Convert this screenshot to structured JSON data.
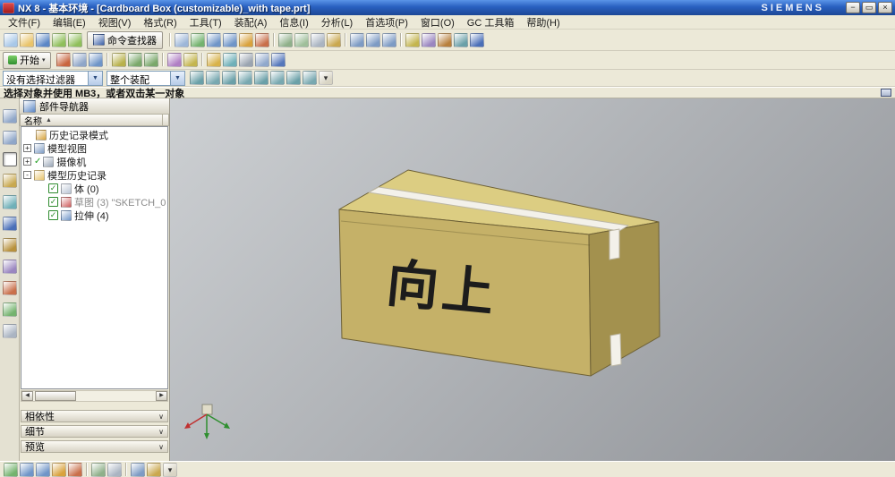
{
  "window": {
    "title": "NX 8 - 基本环境 - [Cardboard Box (customizable)_with tape.prt]",
    "brand": "SIEMENS",
    "controls": {
      "minimize": "−",
      "restore": "▭",
      "close": "×"
    }
  },
  "menu": {
    "items": [
      "文件(F)",
      "编辑(E)",
      "视图(V)",
      "格式(R)",
      "工具(T)",
      "装配(A)",
      "信息(I)",
      "分析(L)",
      "首选项(P)",
      "窗口(O)",
      "GC 工具箱",
      "帮助(H)"
    ]
  },
  "toolbars": {
    "standard": {
      "command_finder_label": "命令查找器",
      "icons_a": [
        {
          "n": "new-icon",
          "c": "#a8c8e8"
        },
        {
          "n": "open-icon",
          "c": "#e9c46a"
        },
        {
          "n": "save-icon",
          "c": "#5b87c6"
        },
        {
          "n": "undo-icon",
          "c": "#8fbf5a"
        },
        {
          "n": "redo-icon",
          "c": "#8fbf5a"
        }
      ],
      "icons_b": [
        {
          "sep": true
        },
        {
          "n": "window-icon",
          "c": "#9db6d8"
        },
        {
          "n": "refresh-icon",
          "c": "#74b36e"
        },
        {
          "n": "fit-window-icon",
          "c": "#6f95c8"
        },
        {
          "n": "zoom-icon",
          "c": "#6f95c8"
        },
        {
          "n": "pan-icon",
          "c": "#d9a23c"
        },
        {
          "n": "rotate-icon",
          "c": "#c96f4a"
        },
        {
          "sep": true
        },
        {
          "n": "shaded-with-edges-icon",
          "c": "#8fb08a"
        },
        {
          "n": "shaded-icon",
          "c": "#9fbf9a"
        },
        {
          "n": "wireframe-icon",
          "c": "#aab4c2"
        },
        {
          "n": "studio-render-icon",
          "c": "#caa84e"
        },
        {
          "sep": true
        },
        {
          "n": "front-view-icon",
          "c": "#7d9bc4"
        },
        {
          "n": "top-view-icon",
          "c": "#7d9bc4"
        },
        {
          "n": "isometric-view-icon",
          "c": "#7d9bc4"
        },
        {
          "sep": true
        },
        {
          "n": "show-hide-icon",
          "c": "#c4b54e"
        },
        {
          "n": "layer-settings-icon",
          "c": "#9a86c0"
        },
        {
          "n": "measure-distance-icon",
          "c": "#b8803c"
        },
        {
          "n": "snap-point-icon",
          "c": "#6aa0a8"
        },
        {
          "n": "help-icon",
          "c": "#4a6fb8"
        }
      ]
    },
    "view": {
      "start_label": "开始",
      "start_arrow": "▾",
      "icons": [
        {
          "n": "sketch-icon",
          "c": "#c9653e"
        },
        {
          "n": "datum-plane-icon",
          "c": "#8fa6c8"
        },
        {
          "n": "extrude-icon",
          "c": "#6f95c8"
        },
        {
          "sep": true
        },
        {
          "n": "point-icon",
          "c": "#b8b14a"
        },
        {
          "n": "line-icon",
          "c": "#7aa86a"
        },
        {
          "n": "arc-icon",
          "c": "#7aa86a"
        },
        {
          "sep": true
        },
        {
          "n": "object-display-icon",
          "c": "#b07fc4"
        },
        {
          "n": "show-hide-toggle-icon",
          "c": "#c4b54e"
        },
        {
          "sep": true
        },
        {
          "n": "information-icon",
          "c": "#d8b24a"
        },
        {
          "n": "analysis-icon",
          "c": "#6fb0b8"
        },
        {
          "n": "preferences-icon",
          "c": "#9aa4b0"
        },
        {
          "n": "window-cascade-icon",
          "c": "#90a8cc"
        },
        {
          "n": "help-doc-icon",
          "c": "#5577bb"
        }
      ]
    },
    "selection": {
      "icons": [
        {
          "n": "snap-point-toggle-icon",
          "c": "#6aa0a8"
        },
        {
          "n": "endpoint-snap-icon",
          "c": "#78a8b0"
        },
        {
          "n": "midpoint-snap-icon",
          "c": "#6aa0a8"
        },
        {
          "n": "control-point-snap-icon",
          "c": "#78a8b0"
        },
        {
          "n": "intersection-snap-icon",
          "c": "#6aa0a8"
        },
        {
          "n": "arc-center-snap-icon",
          "c": "#78a8b0"
        },
        {
          "n": "quadrant-snap-icon",
          "c": "#6aa0a8"
        },
        {
          "n": "existing-point-snap-icon",
          "c": "#78a8b0"
        },
        {
          "n": "overflow-chevron-icon",
          "c": "#d8d4c4",
          "g": "▾"
        }
      ]
    },
    "bottom": {
      "icons": [
        {
          "n": "refresh-view-icon",
          "c": "#74b36e"
        },
        {
          "n": "fit-view-icon",
          "c": "#6f95c8"
        },
        {
          "n": "zoom-view-icon",
          "c": "#6f95c8"
        },
        {
          "n": "pan-view-icon",
          "c": "#d9a23c"
        },
        {
          "n": "rotate-view-icon",
          "c": "#c96f4a"
        },
        {
          "sep": true
        },
        {
          "n": "shaded-mode-icon",
          "c": "#8fb08a"
        },
        {
          "n": "wireframe-mode-icon",
          "c": "#aab4c2"
        },
        {
          "sep": true
        },
        {
          "n": "trimetric-view-icon",
          "c": "#7d9bc4"
        },
        {
          "n": "snapshot-icon",
          "c": "#caa84e"
        },
        {
          "n": "overflow-chevron-icon",
          "c": "#d8d4c4",
          "g": "▾"
        }
      ]
    }
  },
  "selection_bar": {
    "filter_value": "没有选择过滤器",
    "scope_value": "整个装配",
    "dropdown_arrow": "▼"
  },
  "prompt": {
    "text": "选择对象并使用 MB3，或者双击某一对象"
  },
  "resource_bar": {
    "icons": [
      {
        "n": "assembly-navigator-icon",
        "c": "#8fa6c8"
      },
      {
        "n": "constraint-navigator-icon",
        "c": "#8fa6c8"
      },
      {
        "n": "part-navigator-icon",
        "c": "#5b87c6",
        "a": true
      },
      {
        "n": "reuse-library-icon",
        "c": "#c8a84e"
      },
      {
        "n": "hd3d-tools-icon",
        "c": "#6fb0b8"
      },
      {
        "n": "web-browser-icon",
        "c": "#4a6fb8"
      },
      {
        "n": "history-palette-icon",
        "c": "#b8913c"
      },
      {
        "n": "process-studio-icon",
        "c": "#9a86c0"
      },
      {
        "n": "manufacturing-wizard-icon",
        "c": "#c96f4a"
      },
      {
        "n": "roles-icon",
        "c": "#74b36e"
      },
      {
        "n": "system-scenes-icon",
        "c": "#aab4c2"
      }
    ]
  },
  "part_navigator": {
    "title": "部件导航器",
    "name_column": "名称",
    "sort_glyph": "▲",
    "check_glyph": "✓",
    "scroll_left": "◀",
    "scroll_right": "▶",
    "section_chevron": "∨",
    "rows": [
      {
        "label": "历史记录模式",
        "icon": "history-mode-icon",
        "ic": "#d8a43c",
        "level": 0
      },
      {
        "label": "模型视图",
        "icon": "model-views-icon",
        "ic": "#7d9bc4",
        "level": 0,
        "expander": "+"
      },
      {
        "label": "摄像机",
        "icon": "cameras-icon",
        "ic": "#9aa7b8",
        "level": 0,
        "expander": "+",
        "check": true
      },
      {
        "label": "模型历史记录",
        "icon": "model-history-folder-icon",
        "ic": "#e9c46a",
        "level": 0,
        "expander": "-"
      },
      {
        "label": "体 (0)",
        "icon": "body-icon",
        "ic": "#b9c4d4",
        "level": 1,
        "checkbox": true
      },
      {
        "label": "草图 (3) \"SKETCH_0",
        "icon": "sketch-feature-icon",
        "ic": "#cf5b5b",
        "level": 1,
        "checkbox": true,
        "muted": true
      },
      {
        "label": "拉伸 (4)",
        "icon": "extrude-feature-icon",
        "ic": "#6f95c8",
        "level": 1,
        "checkbox": true
      }
    ],
    "sections": [
      "相依性",
      "细节",
      "预览"
    ]
  },
  "viewport": {
    "box_label": "向上"
  }
}
